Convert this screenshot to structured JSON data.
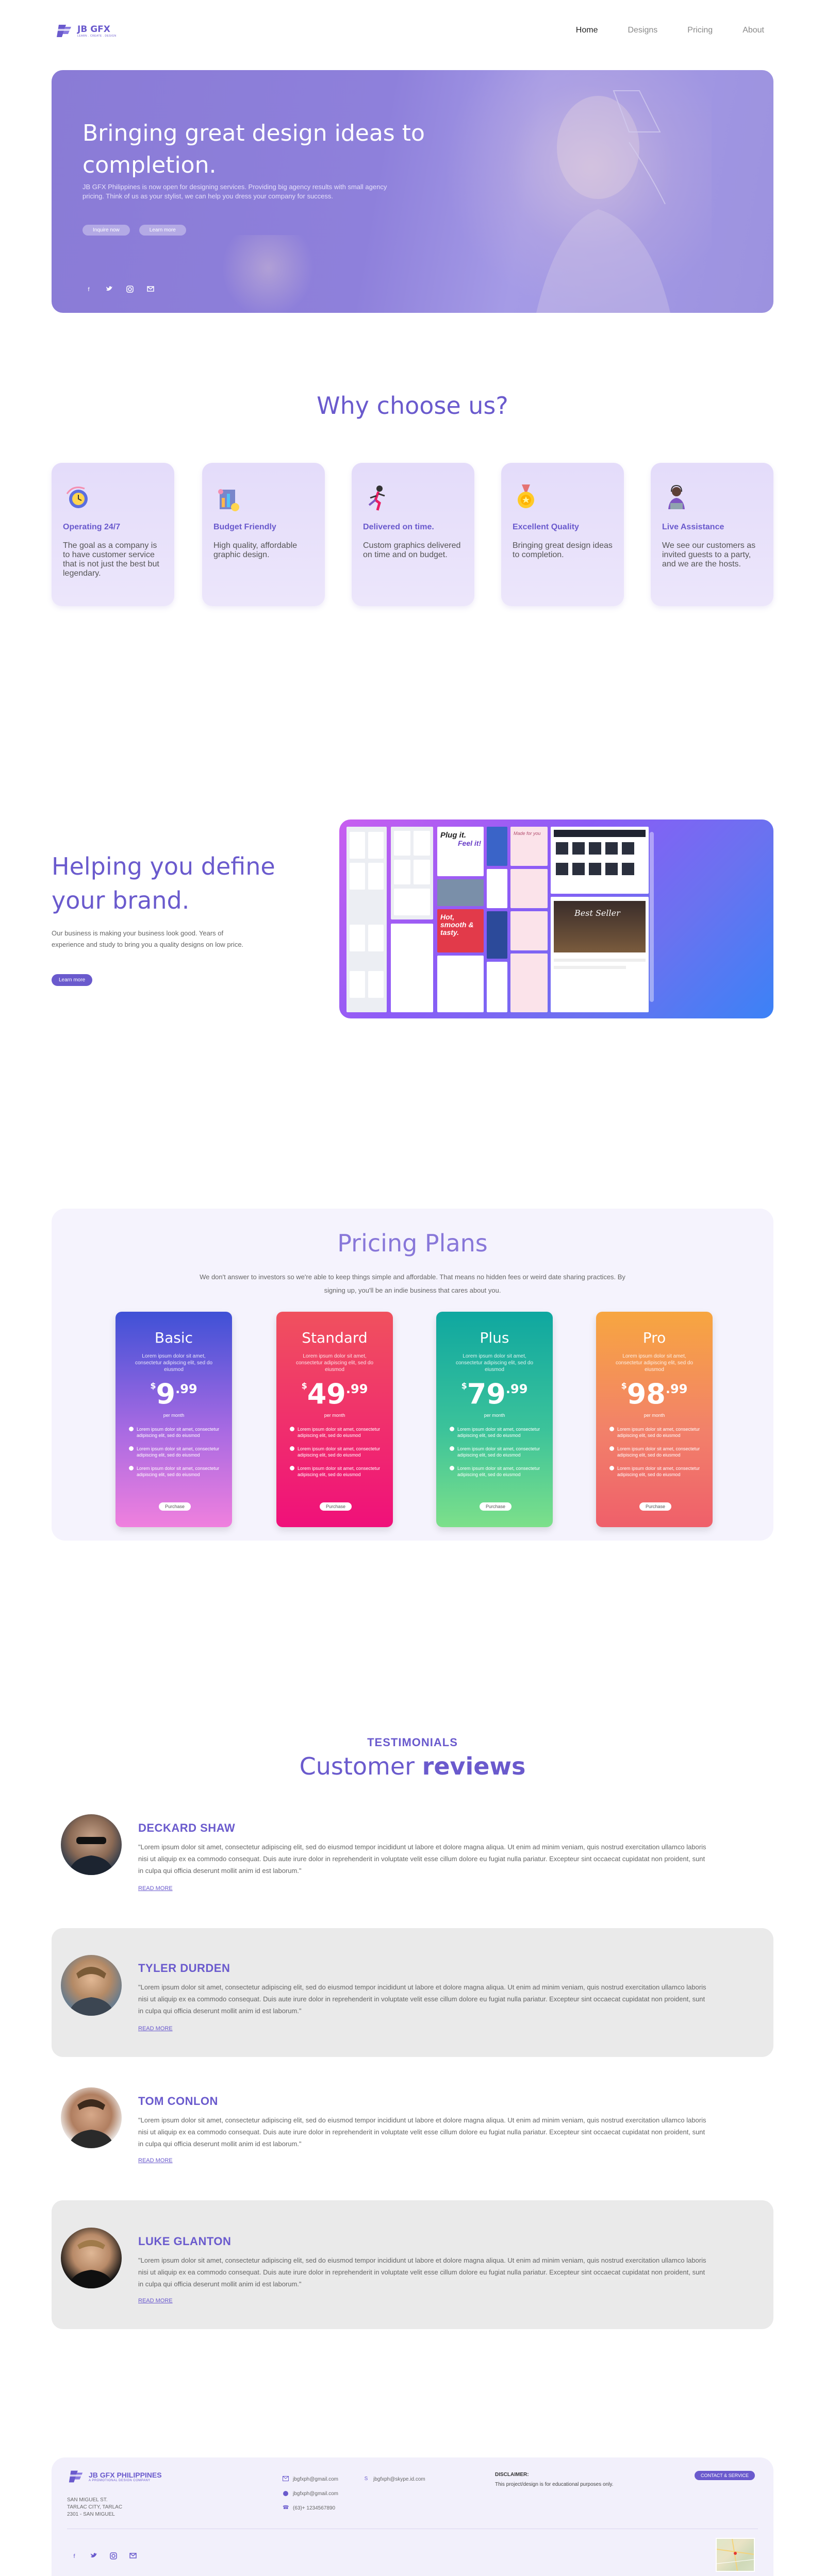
{
  "nav": {
    "brand": "JB GFX",
    "brand_sub": "LEARN . CREATE . DESIGN",
    "links": [
      "Home",
      "Designs",
      "Pricing",
      "About"
    ],
    "active": "Home"
  },
  "hero": {
    "title": "Bringing great design ideas to completion.",
    "description": "JB GFX Philippines is now open for designing services. Providing big agency results with small agency pricing. Think of us as your stylist, we can help you dress your company for success.",
    "buttons": [
      "Inquire now",
      "Learn more"
    ],
    "social_icons": [
      "facebook-icon",
      "twitter-icon",
      "instagram-icon",
      "mail-icon"
    ],
    "colors": {
      "overlay": "#8a7bd6"
    }
  },
  "why": {
    "title": "Why choose us?",
    "cards": [
      {
        "title": "Operating 24/7",
        "text": "The goal as a company is to have customer service that is not just the best but legendary.",
        "icon": "clock-globe-icon"
      },
      {
        "title": "Budget Friendly",
        "text": "High quality, affordable graphic design.",
        "icon": "coins-chart-icon"
      },
      {
        "title": "Delivered on time.",
        "text": "Custom graphics delivered on time and on budget.",
        "icon": "runner-icon"
      },
      {
        "title": "Excellent Quality",
        "text": "Bringing great design ideas to completion.",
        "icon": "medal-icon"
      },
      {
        "title": "Live Assistance",
        "text": "We see our customers as invited guests to a party, and we are the hosts.",
        "icon": "support-agent-icon"
      }
    ]
  },
  "help": {
    "title": "Helping you define your brand.",
    "description": "Our business is making your business look good. Years of experience and study to bring you a quality designs on low price.",
    "button": "Learn more",
    "mock_text": [
      "Plug it.",
      "Feel it!",
      "Hot, smooth & tasty.",
      "Made for you",
      "Best Seller"
    ]
  },
  "pricing": {
    "title": "Pricing Plans",
    "description": "We don't answer to investors so we're able to keep things simple and affordable. That means no hidden fees or weird date sharing practices. By signing up, you'll be an indie business that cares about you.",
    "plans": [
      {
        "name": "Basic",
        "subtitle": "Lorem ipsum dolor sit amet, consectetur adipiscing elit, sed do eiusmod",
        "currency": "$",
        "dollars": "9",
        "cents": ".99",
        "period": "per month",
        "features": [
          "Lorem ipsum dolor sit amet, consectetur adipiscing elit, sed do eiusmod",
          "Lorem ipsum dolor sit amet, consectetur adipiscing elit, sed do eiusmod",
          "Lorem ipsum dolor sit amet, consectetur adipiscing elit, sed do eiusmod"
        ],
        "button": "Purchase",
        "gradient": [
          "#3f51d6",
          "#f080de"
        ]
      },
      {
        "name": "Standard",
        "subtitle": "Lorem ipsum dolor sit amet, consectetur adipiscing elit, sed do eiusmod",
        "currency": "$",
        "dollars": "49",
        "cents": ".99",
        "period": "per month",
        "features": [
          "Lorem ipsum dolor sit amet, consectetur adipiscing elit, sed do eiusmod",
          "Lorem ipsum dolor sit amet, consectetur adipiscing elit, sed do eiusmod",
          "Lorem ipsum dolor sit amet, consectetur adipiscing elit, sed do eiusmod"
        ],
        "button": "Purchase",
        "gradient": [
          "#f0515e",
          "#f0107a"
        ]
      },
      {
        "name": "Plus",
        "subtitle": "Lorem ipsum dolor sit amet, consectetur adipiscing elit, sed do eiusmod",
        "currency": "$",
        "dollars": "79",
        "cents": ".99",
        "period": "per month",
        "features": [
          "Lorem ipsum dolor sit amet, consectetur adipiscing elit, sed do eiusmod",
          "Lorem ipsum dolor sit amet, consectetur adipiscing elit, sed do eiusmod",
          "Lorem ipsum dolor sit amet, consectetur adipiscing elit, sed do eiusmod"
        ],
        "button": "Purchase",
        "gradient": [
          "#0fa7a0",
          "#7de08a"
        ]
      },
      {
        "name": "Pro",
        "subtitle": "Lorem ipsum dolor sit amet, consectetur adipiscing elit, sed do eiusmod",
        "currency": "$",
        "dollars": "98",
        "cents": ".99",
        "period": "per month",
        "features": [
          "Lorem ipsum dolor sit amet, consectetur adipiscing elit, sed do eiusmod",
          "Lorem ipsum dolor sit amet, consectetur adipiscing elit, sed do eiusmod",
          "Lorem ipsum dolor sit amet, consectetur adipiscing elit, sed do eiusmod"
        ],
        "button": "Purchase",
        "gradient": [
          "#f7a640",
          "#ef5f6a"
        ]
      }
    ]
  },
  "testimonials": {
    "eyebrow": "TESTIMONIALS",
    "title_light": "Customer ",
    "title_bold": "reviews",
    "reviews": [
      {
        "name": "DECKARD SHAW",
        "text": "\"Lorem ipsum dolor sit amet, consectetur adipiscing elit, sed do eiusmod tempor incididunt ut labore et dolore magna aliqua. Ut enim ad minim veniam, quis nostrud exercitation ullamco laboris nisi ut aliquip ex ea commodo consequat. Duis aute irure dolor in reprehenderit in voluptate velit esse cillum dolore eu fugiat nulla pariatur. Excepteur sint occaecat cupidatat non proident, sunt in culpa qui officia deserunt mollit anim id est laborum.\"",
        "more": "READ MORE",
        "shaded": false
      },
      {
        "name": "TYLER DURDEN",
        "text": "\"Lorem ipsum dolor sit amet, consectetur adipiscing elit, sed do eiusmod tempor incididunt ut labore et dolore magna aliqua. Ut enim ad minim veniam, quis nostrud exercitation ullamco laboris nisi ut aliquip ex ea commodo consequat. Duis aute irure dolor in reprehenderit in voluptate velit esse cillum dolore eu fugiat nulla pariatur. Excepteur sint occaecat cupidatat non proident, sunt in culpa qui officia deserunt mollit anim id est laborum.\"",
        "more": "READ MORE",
        "shaded": true
      },
      {
        "name": "TOM CONLON",
        "text": "\"Lorem ipsum dolor sit amet, consectetur adipiscing elit, sed do eiusmod tempor incididunt ut labore et dolore magna aliqua. Ut enim ad minim veniam, quis nostrud exercitation ullamco laboris nisi ut aliquip ex ea commodo consequat. Duis aute irure dolor in reprehenderit in voluptate velit esse cillum dolore eu fugiat nulla pariatur. Excepteur sint occaecat cupidatat non proident, sunt in culpa qui officia deserunt mollit anim id est laborum.\"",
        "more": "READ MORE",
        "shaded": false
      },
      {
        "name": "LUKE GLANTON",
        "text": "\"Lorem ipsum dolor sit amet, consectetur adipiscing elit, sed do eiusmod tempor incididunt ut labore et dolore magna aliqua. Ut enim ad minim veniam, quis nostrud exercitation ullamco laboris nisi ut aliquip ex ea commodo consequat. Duis aute irure dolor in reprehenderit in voluptate velit esse cillum dolore eu fugiat nulla pariatur. Excepteur sint occaecat cupidatat non proident, sunt in culpa qui officia deserunt mollit anim id est laborum.\"",
        "more": "READ MORE",
        "shaded": true
      }
    ]
  },
  "footer": {
    "brand": "JB GFX PHILIPPINES",
    "brand_sub": "A PROMOTIONAL DESIGN COMPANY",
    "address": [
      "SAN MIGUEL ST.",
      "TARLAC CITY, TARLAC",
      "2301 - SAN MIGUEL"
    ],
    "email": "jbgfxph@gmail.com",
    "skype": "jbgfxph@skype.id.com",
    "whatsapp": "jbgfxph@gmail.com",
    "phone": "(63)+ 1234567890",
    "disclaimer_title": "DISCLAIMER:",
    "disclaimer_text": "This project/design is for educational purposes only.",
    "cta": "CONTACT & SERVICE",
    "social_icons": [
      "facebook-icon",
      "twitter-icon",
      "instagram-icon",
      "mail-icon"
    ]
  }
}
